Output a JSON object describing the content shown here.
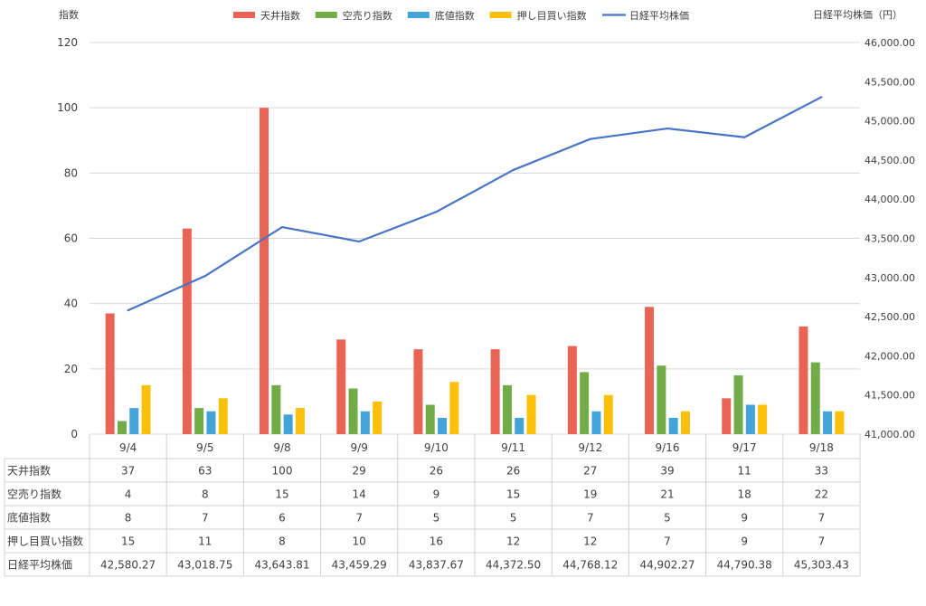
{
  "chart_data": {
    "type": "bar",
    "left_axis_title": "指数",
    "right_axis_title": "日経平均株価（円）",
    "categories": [
      "9/4",
      "9/5",
      "9/8",
      "9/9",
      "9/10",
      "9/11",
      "9/12",
      "9/16",
      "9/17",
      "9/18"
    ],
    "series": [
      {
        "name": "天井指数",
        "type": "bar",
        "axis": "left",
        "color": "#e96455",
        "values": [
          37,
          63,
          100,
          29,
          26,
          26,
          27,
          39,
          11,
          33
        ]
      },
      {
        "name": "空売り指数",
        "type": "bar",
        "axis": "left",
        "color": "#72ac48",
        "values": [
          4,
          8,
          15,
          14,
          9,
          15,
          19,
          21,
          18,
          22
        ]
      },
      {
        "name": "底値指数",
        "type": "bar",
        "axis": "left",
        "color": "#44a3d8",
        "values": [
          8,
          7,
          6,
          7,
          5,
          5,
          7,
          5,
          9,
          7
        ]
      },
      {
        "name": "押し目買い指数",
        "type": "bar",
        "axis": "left",
        "color": "#fbc00a",
        "values": [
          15,
          11,
          8,
          10,
          16,
          12,
          12,
          7,
          9,
          7
        ]
      },
      {
        "name": "日経平均株価",
        "type": "line",
        "axis": "right",
        "color": "#4a74c5",
        "values": [
          42580.27,
          43018.75,
          43643.81,
          43459.29,
          43837.67,
          44372.5,
          44768.12,
          44902.27,
          44790.38,
          45303.43
        ]
      }
    ],
    "left_ylim": [
      0,
      120
    ],
    "left_ticks": [
      0,
      20,
      40,
      60,
      80,
      100,
      120
    ],
    "right_ylim": [
      41000,
      46000
    ],
    "right_ticks": [
      "41,000.00",
      "41,500.00",
      "42,000.00",
      "42,500.00",
      "43,000.00",
      "43,500.00",
      "44,000.00",
      "44,500.00",
      "45,000.00",
      "45,500.00",
      "46,000.00"
    ],
    "table_rows": [
      {
        "label": "天井指数",
        "cells": [
          "37",
          "63",
          "100",
          "29",
          "26",
          "26",
          "27",
          "39",
          "11",
          "33"
        ]
      },
      {
        "label": "空売り指数",
        "cells": [
          "4",
          "8",
          "15",
          "14",
          "9",
          "15",
          "19",
          "21",
          "18",
          "22"
        ]
      },
      {
        "label": "底値指数",
        "cells": [
          "8",
          "7",
          "6",
          "7",
          "5",
          "5",
          "7",
          "5",
          "9",
          "7"
        ]
      },
      {
        "label": "押し目買い指数",
        "cells": [
          "15",
          "11",
          "8",
          "10",
          "16",
          "12",
          "12",
          "7",
          "9",
          "7"
        ]
      },
      {
        "label": "日経平均株価",
        "cells": [
          "42,580.27",
          "43,018.75",
          "43,643.81",
          "43,459.29",
          "43,837.67",
          "44,372.50",
          "44,768.12",
          "44,902.27",
          "44,790.38",
          "45,303.43"
        ]
      }
    ],
    "grid": true,
    "legend_position": "top-center",
    "data_table": true
  }
}
